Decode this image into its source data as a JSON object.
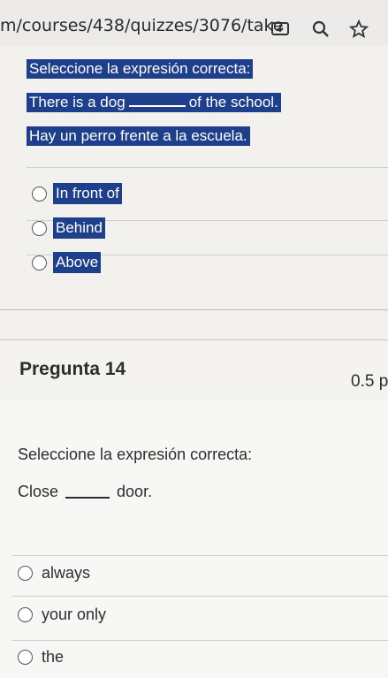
{
  "browser": {
    "url": "m/courses/438/quizzes/3076/take"
  },
  "question13": {
    "instruction": "Seleccione la expresión correcta:",
    "sentence_before": "There is a dog",
    "sentence_after": "of the school.",
    "translation": "Hay un perro frente a la escuela.",
    "options": [
      "In front of",
      "Behind",
      "Above"
    ]
  },
  "question14": {
    "title": "Pregunta 14",
    "points": "0.5 p",
    "instruction": "Seleccione la expresión correcta:",
    "sentence_before": "Close",
    "sentence_after": "door.",
    "options": [
      "always",
      "your only",
      "the"
    ]
  },
  "colors": {
    "highlight": "#1d3f8c",
    "background": "#f2f1ee"
  }
}
